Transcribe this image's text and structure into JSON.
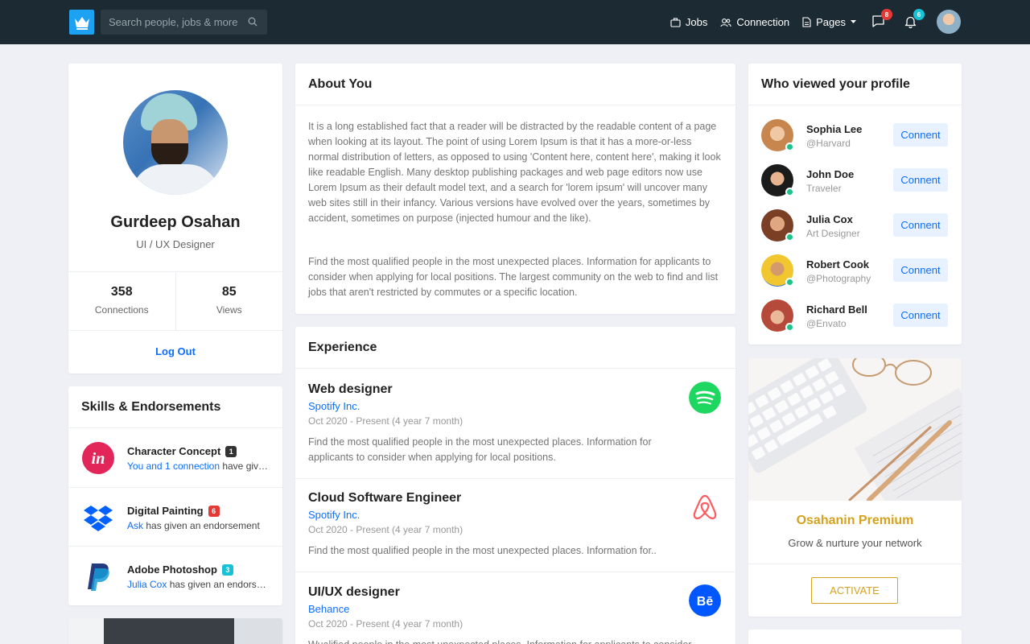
{
  "nav": {
    "search_placeholder": "Search people, jobs & more...",
    "links": [
      {
        "label": "Jobs",
        "icon": "briefcase-icon"
      },
      {
        "label": "Connection",
        "icon": "users-icon"
      },
      {
        "label": "Pages",
        "icon": "file-icon"
      }
    ],
    "messages_count": "8",
    "notifications_count": "6"
  },
  "profile": {
    "name": "Gurdeep Osahan",
    "role": "UI / UX Designer",
    "connections_value": "358",
    "connections_label": "Connections",
    "views_value": "85",
    "views_label": "Views",
    "logout_label": "Log Out"
  },
  "skills": {
    "title": "Skills & Endorsements",
    "items": [
      {
        "name": "Character Concept",
        "count": "1",
        "count_color": "#333333",
        "link": "You and 1 connection",
        "rest": " have given an endorsement"
      },
      {
        "name": "Digital Painting",
        "count": "6",
        "count_color": "#e53935",
        "link": "Ask",
        "rest": " has given an endorsement"
      },
      {
        "name": "Adobe Photoshop",
        "count": "3",
        "count_color": "#17c1d6",
        "link": "Julia Cox",
        "rest": " has given an endorsement"
      }
    ]
  },
  "about": {
    "title": "About You",
    "p1": "It is a long established fact that a reader will be distracted by the readable content of a page when looking at its layout. The point of using Lorem Ipsum is that it has a more-or-less normal distribution of letters, as opposed to using 'Content here, content here', making it look like readable English. Many desktop publishing packages and web page editors now use Lorem Ipsum as their default model text, and a search for 'lorem ipsum' will uncover many web sites still in their infancy. Various versions have evolved over the years, sometimes by accident, sometimes on purpose (injected humour and the like).",
    "p2": "Find the most qualified people in the most unexpected places. Information for applicants to consider when applying for local positions. The largest community on the web to find and list jobs that aren't restricted by commutes or a specific location."
  },
  "experience": {
    "title": "Experience",
    "items": [
      {
        "title": "Web designer",
        "company": "Spotify Inc.",
        "date": "Oct 2020 - Present (4 year 7 month)",
        "desc": "Find the most qualified people in the most unexpected places. Information for applicants to consider when applying for local positions.",
        "logo": "spotify-logo"
      },
      {
        "title": "Cloud Software Engineer",
        "company": "Spotify Inc.",
        "date": "Oct 2020 - Present (4 year 7 month)",
        "desc": "Find the most qualified people in the most unexpected places. Information for..",
        "logo": "airbnb-logo"
      },
      {
        "title": "UI/UX designer",
        "company": "Behance",
        "date": "Oct 2020 - Present (4 year 7 month)",
        "desc": "Wualified people in the most unexpected places. Information for applicants to consider",
        "logo": "behance-logo"
      }
    ]
  },
  "viewers": {
    "title": "Who viewed your profile",
    "button_label": "Connent",
    "items": [
      {
        "name": "Sophia Lee",
        "sub": "@Harvard"
      },
      {
        "name": "John Doe",
        "sub": "Traveler"
      },
      {
        "name": "Julia Cox",
        "sub": "Art Designer"
      },
      {
        "name": "Robert Cook",
        "sub": "@Photography"
      },
      {
        "name": "Richard Bell",
        "sub": "@Envato"
      }
    ]
  },
  "premium": {
    "title": "Osahanin Premium",
    "subtitle": "Grow & nurture your network",
    "button_label": "ACTIVATE"
  },
  "colors": {
    "navbar": "#1c2a33",
    "accent": "#0d6efd",
    "premium": "#d4a21e",
    "online": "#1fc28a"
  }
}
